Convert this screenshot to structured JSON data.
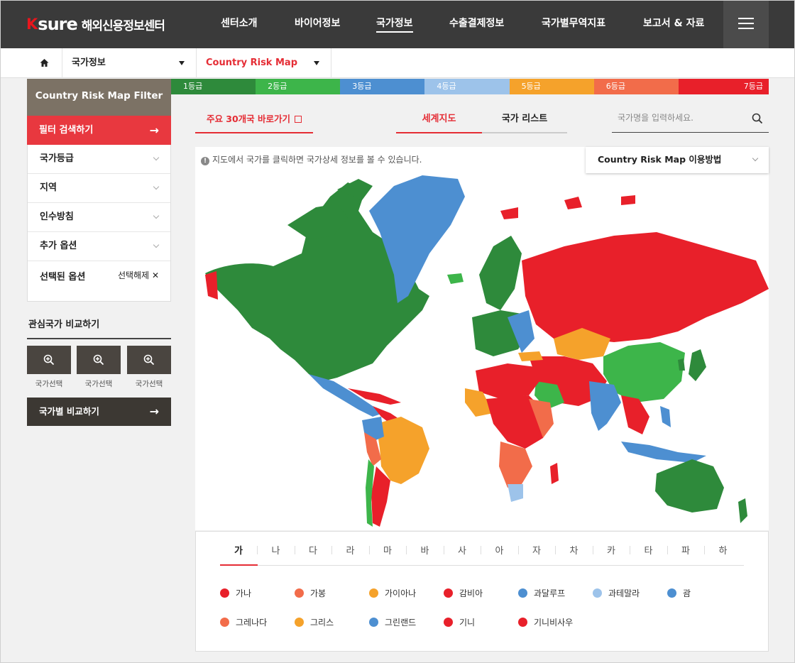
{
  "header": {
    "logo_k": "K",
    "logo_sure": "sure",
    "logo_text": "해외신용정보센터",
    "nav": [
      "센터소개",
      "바이어정보",
      "국가정보",
      "수출결제정보",
      "국가별무역지표",
      "보고서 & 자료"
    ],
    "active_nav": "국가정보"
  },
  "breadcrumb": {
    "level1": "국가정보",
    "level2": "Country Risk Map"
  },
  "grades": [
    {
      "label": "1등급",
      "color": "#2e8a3b"
    },
    {
      "label": "2등급",
      "color": "#3db54a"
    },
    {
      "label": "3등급",
      "color": "#4d8fd1"
    },
    {
      "label": "4등급",
      "color": "#9dc3ea"
    },
    {
      "label": "5등급",
      "color": "#f5a22b"
    },
    {
      "label": "6등급",
      "color": "#f26c4a"
    },
    {
      "label": "7등급",
      "color": "#e8202a"
    }
  ],
  "filter": {
    "title": "Country Risk Map Filter",
    "search_label": "필터 검색하기",
    "items": [
      "국가등급",
      "지역",
      "인수방침",
      "추가 옵션"
    ],
    "selected_label": "선택된 옵션",
    "reset_label": "선택해제"
  },
  "compare": {
    "title": "관심국가 비교하기",
    "slots": [
      "국가선택",
      "국가선택",
      "국가선택"
    ],
    "button_label": "국가별 비교하기"
  },
  "main": {
    "top30_label": "주요 30개국 바로가기",
    "tab_map": "세계지도",
    "tab_list": "국가 리스트",
    "search_placeholder": "국가명을 입력하세요.",
    "notice": "지도에서 국가를 클릭하면 국가상세 정보를 볼 수 있습니다.",
    "howto_label": "Country Risk Map 이용방법"
  },
  "index": {
    "letters": [
      "가",
      "나",
      "다",
      "라",
      "마",
      "바",
      "사",
      "아",
      "자",
      "차",
      "카",
      "타",
      "파",
      "하"
    ],
    "active_letter": "가",
    "countries": [
      {
        "name": "가나",
        "color": "#e8202a"
      },
      {
        "name": "가봉",
        "color": "#f26c4a"
      },
      {
        "name": "가이아나",
        "color": "#f5a22b"
      },
      {
        "name": "감비아",
        "color": "#e8202a"
      },
      {
        "name": "과달루프",
        "color": "#4d8fd1"
      },
      {
        "name": "과테말라",
        "color": "#9dc3ea"
      },
      {
        "name": "괌",
        "color": "#4d8fd1"
      },
      {
        "name": "그레나다",
        "color": "#f26c4a"
      },
      {
        "name": "그리스",
        "color": "#f5a22b"
      },
      {
        "name": "그린랜드",
        "color": "#4d8fd1"
      },
      {
        "name": "기니",
        "color": "#e8202a"
      },
      {
        "name": "기니비사우",
        "color": "#e8202a"
      }
    ]
  }
}
